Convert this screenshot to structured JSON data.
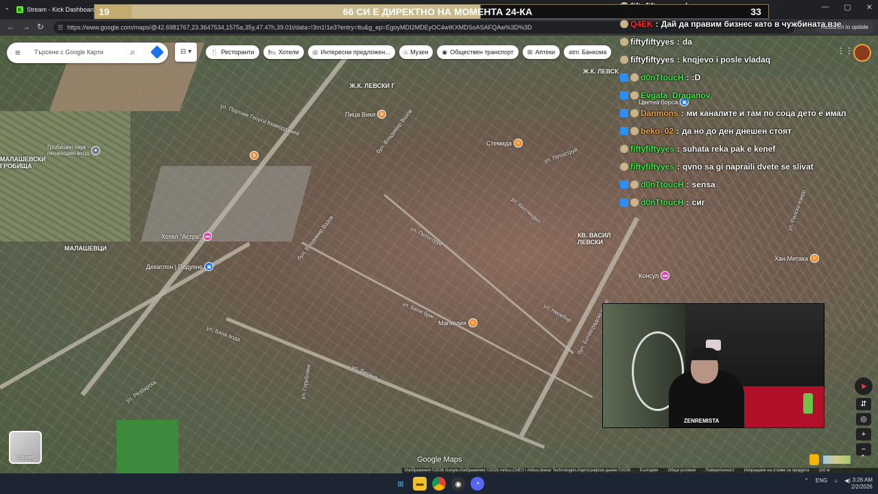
{
  "browser": {
    "tab_title": "Stream - Kick Dashboard",
    "tab_icon": "K",
    "url": "https://www.google.com/maps/@42.6981767,23.3647534,1575a,35y,47.47h,39.01t/data=!3m1!1e3?entry=ttu&g_ep=EgoyMDI2MDEyOC4wIKXMDSoASAFQAw%3D%3D",
    "relaunch_label": "Relaunch to update"
  },
  "stream_title": {
    "left_number": "19",
    "text": "66 СИ Е ДИРЕКТНО НА МОМЕНТА 24-КА",
    "right_number": "33"
  },
  "maps": {
    "search_placeholder": "Търсене с Google Карти",
    "chips": [
      {
        "icon": "fork-knife-icon",
        "glyph": "🍴",
        "label": "Ресторанти"
      },
      {
        "icon": "bed-icon",
        "glyph": "🛏",
        "label": "Хотели"
      },
      {
        "icon": "tag-icon",
        "glyph": "◎",
        "label": "Интересни предложен..."
      },
      {
        "icon": "museum-icon",
        "glyph": "⌂",
        "label": "Музеи"
      },
      {
        "icon": "bus-icon",
        "glyph": "◉",
        "label": "Обществен транспорт"
      },
      {
        "icon": "pharmacy-icon",
        "glyph": "⊞",
        "label": "Аптеки"
      },
      {
        "icon": "atm-icon",
        "glyph": "atm",
        "label": "Банкома"
      }
    ],
    "area_labels": {
      "malashevtsi": "МАЛАШЕВЦИ",
      "malashevsko": "МАЛАШЕВСКИ\nГРОБИЩА",
      "levski_g": "Ж.К. ЛЕВСКИ Г",
      "levski_top": "Ж.К. ЛЕВСК",
      "vasil_levski": "КВ. ВАСИЛ\nЛЕВСКИ"
    },
    "poi": {
      "hotel_astra": "Хотел \"Астра\"",
      "decathlon": "Декатлон | Подуяне",
      "pitsa_viki": "Пица Вики",
      "stemida": "Стемида",
      "magnolia": "Магнолия",
      "konsul": "Консул",
      "han_mitaka": "Хан Митака",
      "tsvetna_borsa": "Цветна борса",
      "grobishten_park": "Гробищен парк -\nпешеходен вход"
    },
    "streets": {
      "vladimir_vazov_1": "бул. Владимир Вазов",
      "vladimir_vazov_2": "бул. Владимир Вазов",
      "g_kyumyurdzhiev": "ул. Портник Георги Кюмюрджиев",
      "petostruj_1": "ул. Петоструй",
      "petostruj_2": "ул. Петоструй",
      "vitinya": "ул. Витиня",
      "beli_briag": "ул. Бели бряг",
      "rezbarska": "ул. Резбарска",
      "nesebar": "ул. Несебър",
      "kyustendil": "ул. Кюстендил",
      "chaykovski": "ул. Горубляне",
      "bela_voda": "ул. Бяла вода",
      "rilsko_ezero": "ул. Рилско езеро",
      "botev": "бул. Ботевградско шосе"
    },
    "layers_label": "Слоеве",
    "logo": "Google Maps",
    "attribution": [
      "Изображения ©2026 Google,Изображения ©2026 Airbus,CNES / Airbus,Maxar Technologies,Картографски данни ©2026",
      "България",
      "Общи условия",
      "Поверителност",
      "Изпращане на отзиви за продукта",
      "100 м"
    ]
  },
  "chat": [
    {
      "user": "fiftyfiftyyes",
      "text": "da",
      "color": "#ffffff",
      "badge": "none"
    },
    {
      "user": "Q4EK",
      "text": "Дай да правим бизнес като в чужбината взе",
      "color": "#ff2a2a",
      "badge": "none"
    },
    {
      "user": "fiftyfiftyyes",
      "text": "da",
      "color": "#ffffff",
      "badge": "none"
    },
    {
      "user": "fiftyfiftyyes",
      "text": "knqjevo i posle vladaq",
      "color": "#ffffff",
      "badge": "none"
    },
    {
      "user": "d0nTtoucH",
      "text": ":D",
      "color": "#3ee64a",
      "badge": "blue"
    },
    {
      "user": "Evgata_Draganov",
      "text": "",
      "color": "#3ee64a",
      "badge": "blue"
    },
    {
      "user": "Danmons",
      "text": "ми каналите и там по соца дето е имал",
      "color": "#f2a43a",
      "badge": "blue"
    },
    {
      "user": "beko_02",
      "text": "да но до ден днешен стоят",
      "color": "#f2a43a",
      "badge": "blue"
    },
    {
      "user": "fiftyfiftyyes",
      "text": "suhata reka pak e kenef",
      "color": "#3ee64a",
      "badge": "none"
    },
    {
      "user": "fiftyfiftyyes",
      "text": "qvno sa gi napraili dvete se slivat",
      "color": "#3ee64a",
      "badge": "none"
    },
    {
      "user": "d0nTtoucH",
      "text": "sensa",
      "color": "#3ee64a",
      "badge": "blue"
    },
    {
      "user": "d0nTtoucH",
      "text": "сиг",
      "color": "#3ee64a",
      "badge": "blue"
    }
  ],
  "webcam": {
    "shirt_text": "ZENREMISTA"
  },
  "taskbar": {
    "lang": "ENG",
    "time": "3:26 AM",
    "date": "2/2/2026"
  }
}
